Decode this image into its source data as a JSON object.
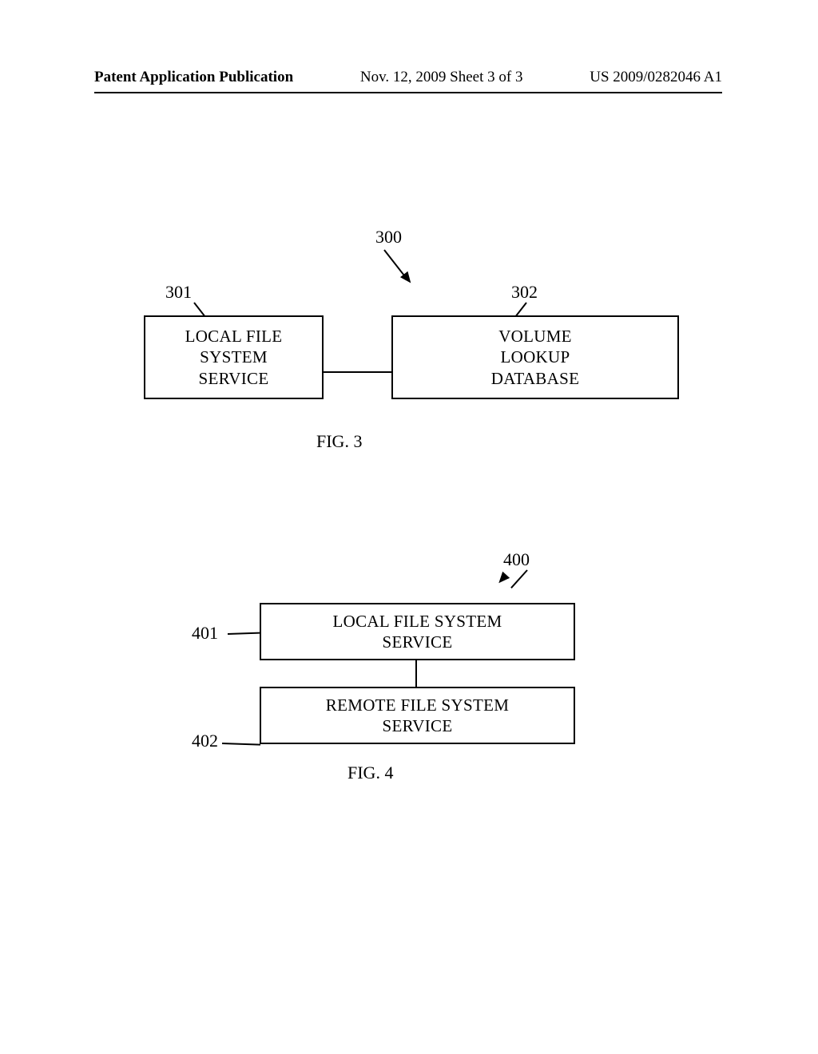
{
  "header": {
    "publication": "Patent Application Publication",
    "date_sheet": "Nov. 12, 2009   Sheet 3 of 3",
    "pub_number": "US 2009/0282046 A1"
  },
  "fig3": {
    "ref": "300",
    "box301": {
      "ref": "301",
      "text": "LOCAL FILE\nSYSTEM\nSERVICE"
    },
    "box302": {
      "ref": "302",
      "text": "VOLUME\nLOOKUP\nDATABASE"
    },
    "caption": "FIG. 3"
  },
  "fig4": {
    "ref": "400",
    "box401": {
      "ref": "401",
      "text": "LOCAL FILE SYSTEM\nSERVICE"
    },
    "box402": {
      "ref": "402",
      "text": "REMOTE FILE SYSTEM\nSERVICE"
    },
    "caption": "FIG. 4"
  }
}
